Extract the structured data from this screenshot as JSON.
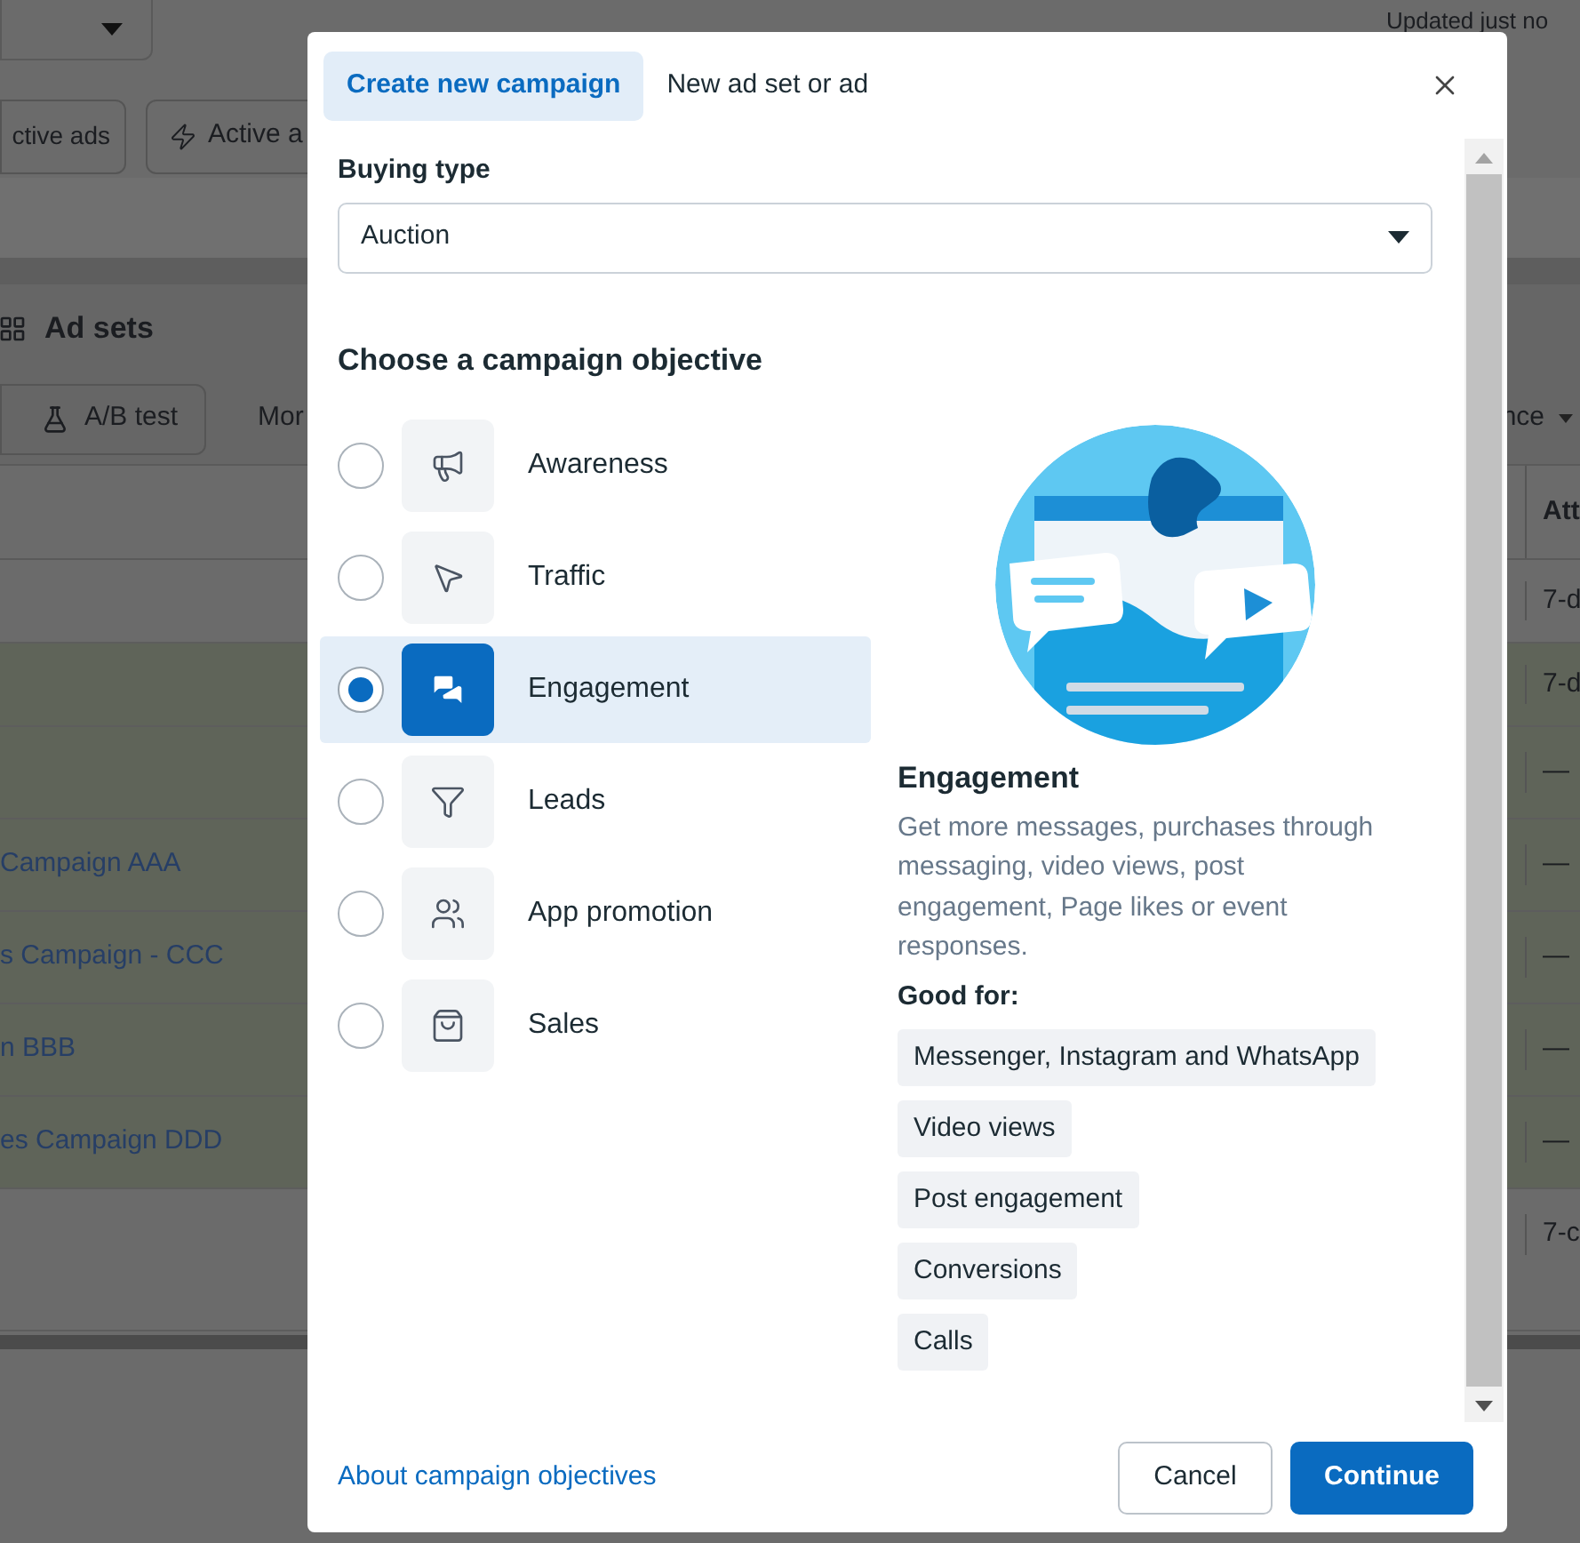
{
  "background": {
    "updated": "Updated just no",
    "filters": [
      "ctive ads",
      "Active a"
    ],
    "section_title": "Ad sets",
    "toolbar": [
      "A/B test",
      "Mor"
    ],
    "right_dropdown": "nce",
    "column_header": "Att",
    "rows": [
      {
        "attribution": "7-d",
        "highlighted": false
      },
      {
        "attribution": "7-d",
        "highlighted": true
      },
      {
        "attribution": "—",
        "highlighted": true
      },
      {
        "campaign": "Campaign AAA",
        "attribution": "—",
        "highlighted": true
      },
      {
        "campaign": "s Campaign - CCC",
        "attribution": "—",
        "highlighted": true
      },
      {
        "campaign": "n BBB",
        "attribution": "—",
        "highlighted": true
      },
      {
        "campaign": "es Campaign DDD",
        "attribution": "—",
        "highlighted": true
      },
      {
        "attribution": "7-c",
        "highlighted": false
      }
    ]
  },
  "modal": {
    "tabs": [
      {
        "label": "Create new campaign",
        "selected": true
      },
      {
        "label": "New ad set or ad",
        "selected": false
      }
    ],
    "buying_type": {
      "label": "Buying type",
      "value": "Auction"
    },
    "objective_heading": "Choose a campaign objective",
    "objectives": [
      {
        "label": "Awareness",
        "kind": "megaphone",
        "selected": false
      },
      {
        "label": "Traffic",
        "kind": "cursor",
        "selected": false
      },
      {
        "label": "Engagement",
        "kind": "chat",
        "selected": true
      },
      {
        "label": "Leads",
        "kind": "funnel",
        "selected": false
      },
      {
        "label": "App promotion",
        "kind": "people",
        "selected": false
      },
      {
        "label": "Sales",
        "kind": "bag",
        "selected": false
      }
    ],
    "detail": {
      "title": "Engagement",
      "description": "Get more messages, purchases through messaging, video views, post engagement, Page likes or event responses.",
      "good_for_label": "Good for:",
      "tags": [
        "Messenger, Instagram and WhatsApp",
        "Video views",
        "Post engagement",
        "Conversions",
        "Calls"
      ]
    },
    "footer": {
      "link": "About campaign objectives",
      "buttons": [
        {
          "label": "Cancel",
          "kind": "secondary"
        },
        {
          "label": "Continue",
          "kind": "primary"
        }
      ]
    }
  }
}
